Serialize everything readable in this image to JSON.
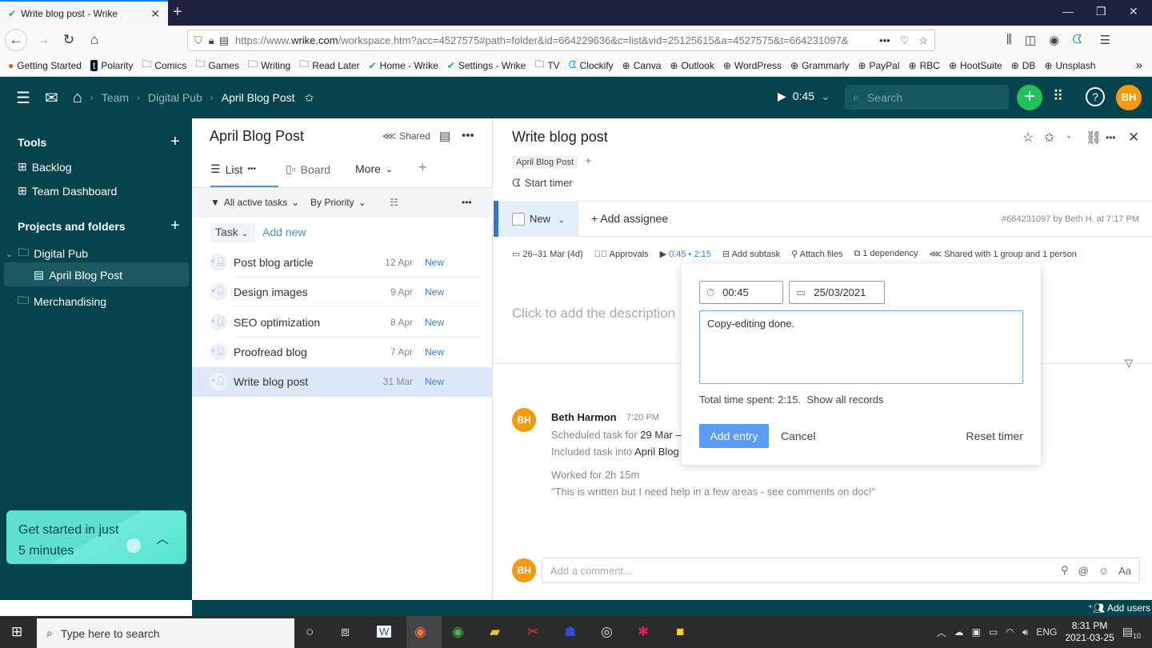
{
  "browser": {
    "tab_title": "Write blog post - Wrike",
    "url_prefix": "https://www.",
    "url_domain": "wrike.com",
    "url_rest": "/workspace.htm?acc=4527575#path=folder&id=664229636&c=list&vid=25125615&a=4527575&t=664231097&",
    "bookmarks": [
      "Getting Started",
      "Polarity",
      "Comics",
      "Games",
      "Writing",
      "Read Later",
      "Home - Wrike",
      "Settings - Wrike",
      "TV",
      "Clockify",
      "Canva",
      "Outlook",
      "WordPress",
      "Grammarly",
      "PayPal",
      "RBC",
      "HootSuite",
      "DB",
      "Unsplash"
    ]
  },
  "header": {
    "breadcrumbs": [
      "Team",
      "Digital Pub",
      "April Blog Post"
    ],
    "timer": "0:45",
    "search_placeholder": "Search",
    "avatar": "BH"
  },
  "sidebar": {
    "tools_label": "Tools",
    "tools": [
      "Backlog",
      "Team Dashboard"
    ],
    "projects_label": "Projects and folders",
    "folders": [
      "Digital Pub",
      "April Blog Post",
      "Merchandising"
    ],
    "get_started": [
      "Get started in just",
      "5 minutes"
    ],
    "add_users": "Add users"
  },
  "list": {
    "title": "April Blog Post",
    "shared": "Shared",
    "tabs": [
      "List",
      "Board",
      "More"
    ],
    "filters": [
      "All active tasks",
      "By Priority"
    ],
    "task_button": "Task",
    "add_new": "Add new",
    "tasks": [
      {
        "name": "Post blog article",
        "date": "12 Apr",
        "status": "New"
      },
      {
        "name": "Design images",
        "date": "9 Apr",
        "status": "New"
      },
      {
        "name": "SEO optimization",
        "date": "8 Apr",
        "status": "New"
      },
      {
        "name": "Proofread blog",
        "date": "7 Apr",
        "status": "New"
      },
      {
        "name": "Write blog post",
        "date": "31 Mar",
        "status": "New"
      }
    ]
  },
  "task": {
    "title": "Write blog post",
    "tag": "April Blog Post",
    "start_timer": "Start timer",
    "status": "New",
    "add_assignee": "+ Add assignee",
    "meta": "#664231097 by Beth H. at 7:17 PM",
    "dates": "26–31 Mar (4d)",
    "approvals": "Approvals",
    "time": "0:45 • 2:15",
    "add_subtask": "Add subtask",
    "attach_files": "Attach files",
    "dependency": "1 dependency",
    "shared_with": "Shared with 1 group and 1 person",
    "description_placeholder": "Click to add the description",
    "comment_placeholder": "Add a comment..."
  },
  "activity": {
    "author": "Beth Harmon",
    "time": "7:20 PM",
    "line1_prefix": "Scheduled task for ",
    "line1_value": "29 Mar –",
    "line2_prefix": "Included task into ",
    "line2_value": "April Blog",
    "worked": "Worked for 2h 15m",
    "quote": "\"This is written but I need help in a few areas - see comments on doc!\""
  },
  "time_popover": {
    "duration": "00:45",
    "date": "25/03/2021",
    "note": "Copy-editing done.",
    "total": "Total time spent: 2:15.",
    "show_all": "Show all records",
    "add_entry": "Add entry",
    "cancel": "Cancel",
    "reset": "Reset timer"
  },
  "taskbar": {
    "search_placeholder": "Type here to search",
    "lang": "ENG",
    "time": "8:31 PM",
    "date": "2021-03-25",
    "notifications": "10"
  }
}
